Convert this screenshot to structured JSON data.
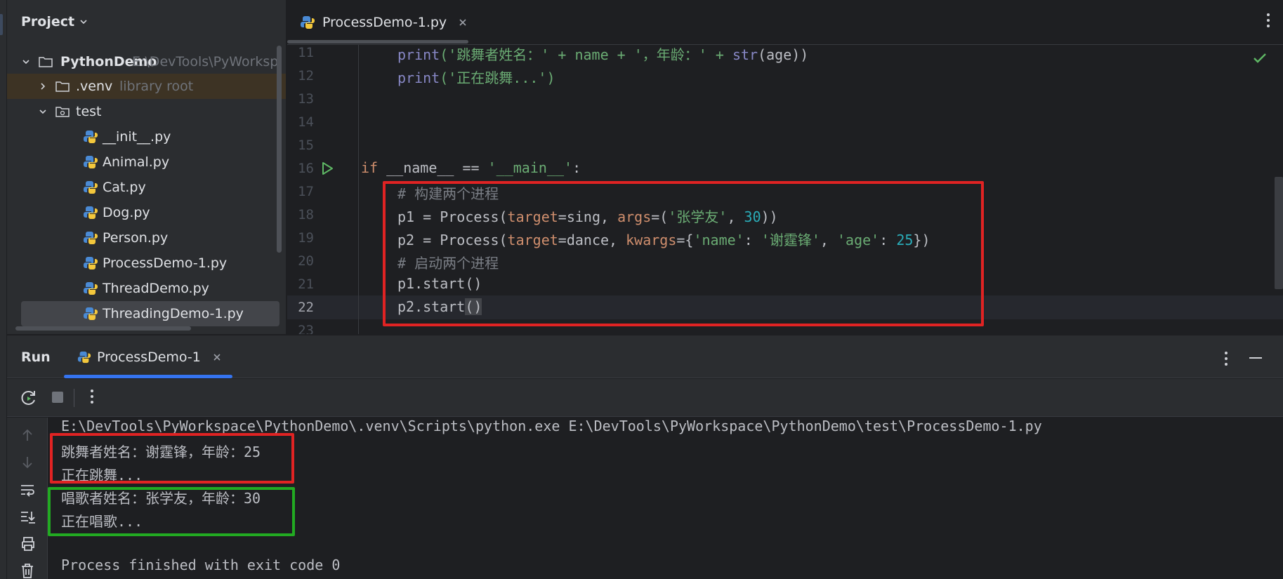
{
  "project": {
    "title": "Project",
    "root_name": "PythonDemo",
    "root_path": "E:\\DevTools\\PyWorksp",
    "venv_name": ".venv",
    "venv_hint": "library root",
    "test_folder": "test",
    "files": [
      "__init__.py",
      "Animal.py",
      "Cat.py",
      "Dog.py",
      "Person.py",
      "ProcessDemo-1.py",
      "ThreadDemo.py",
      "ThreadingDemo-1.py"
    ]
  },
  "editor": {
    "tab_label": "ProcessDemo-1.py",
    "line_numbers": [
      "11",
      "12",
      "13",
      "14",
      "15",
      "16",
      "17",
      "18",
      "19",
      "20",
      "21",
      "22",
      "23"
    ],
    "current_line": "22",
    "code": {
      "l11_a": "print",
      "l11_b": "('跳舞者姓名：' + name + '，年龄：' + ",
      "l11_c": "str",
      "l11_d": "(age))",
      "l12_a": "print",
      "l12_b": "('正在跳舞...')",
      "l16_kw": "if",
      "l16_rest": " __name__ == ",
      "l16_str": "'__main__'",
      "l16_end": ":",
      "l17": "# 构建两个进程",
      "l18_a": "p1 = Process(",
      "l18_b": "target",
      "l18_c": "=sing, ",
      "l18_d": "args",
      "l18_e": "=(",
      "l18_f": "'张学友'",
      "l18_g": ", ",
      "l18_h": "30",
      "l18_i": "))",
      "l19_a": "p2 = Process(",
      "l19_b": "target",
      "l19_c": "=dance, ",
      "l19_d": "kwargs",
      "l19_e": "={",
      "l19_f": "'name'",
      "l19_g": ": ",
      "l19_h": "'谢霆锋'",
      "l19_i": ", ",
      "l19_j": "'age'",
      "l19_k": ": ",
      "l19_l": "25",
      "l19_m": "})",
      "l20": "# 启动两个进程",
      "l21": "p1.start()",
      "l22_a": "p2.start",
      "l22_b": "()"
    }
  },
  "run": {
    "title": "Run",
    "tab_label": "ProcessDemo-1",
    "console": [
      "E:\\DevTools\\PyWorkspace\\PythonDemo\\.venv\\Scripts\\python.exe E:\\DevTools\\PyWorkspace\\PythonDemo\\test\\ProcessDemo-1.py",
      "跳舞者姓名：谢霆锋，年龄：25",
      "正在跳舞...",
      "唱歌者姓名：张学友，年龄：30",
      "正在唱歌...",
      "",
      "Process finished with exit code 0"
    ]
  },
  "colors": {
    "highlight_red": "#e02323",
    "highlight_green": "#22aa22",
    "accent_blue": "#3574f0"
  }
}
